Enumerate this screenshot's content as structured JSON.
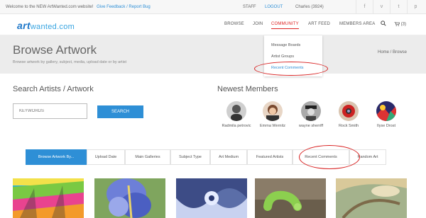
{
  "topbar": {
    "welcome": "Welcome to the NEW ArtWanted.com website!",
    "feedback_link": "Give Feedback / Report Bug",
    "staff": "STAFF",
    "logout": "LOGOUT",
    "user": "Charles (3924)",
    "social_icons": [
      "facebook-icon",
      "vimeo-icon",
      "twitter-icon",
      "pinterest-icon",
      "instagram-icon"
    ],
    "social_glyphs": [
      "f",
      "v",
      "t",
      "p",
      "◎"
    ]
  },
  "nav": {
    "logo_art": "art",
    "logo_rest": "wanted.com",
    "items": [
      "BROWSE",
      "JOIN",
      "COMMUNITY",
      "ART FEED",
      "MEMBERS AREA"
    ],
    "active": "COMMUNITY",
    "search_icon": "search-icon",
    "cart": "(3)"
  },
  "community_menu": {
    "items": [
      "Message Boards",
      "Artist Groups",
      "Recent Comments"
    ],
    "active": "Recent Comments"
  },
  "header": {
    "title": "Browse Artwork",
    "subtitle": "Browse artwork by gallery, subject, media, upload date or by artist",
    "breadcrumb": "Home / Browse"
  },
  "search": {
    "title": "Search Artists / Artwork",
    "placeholder": "KEYWORDS",
    "button": "SEARCH"
  },
  "members": {
    "title": "Newest Members",
    "list": [
      "Radmila petrovic",
      "Emma Wernitz",
      "wayne sherriff",
      "Rock Smith",
      "Ilyse Drost"
    ]
  },
  "tabs": {
    "items": [
      "Browse Artwork By...",
      "Upload Date",
      "Main Galleries",
      "Subject Type",
      "Art Medium",
      "Featured Artists",
      "Recent Comments",
      "Random Art"
    ],
    "active": "Browse Artwork By..."
  },
  "colors": {
    "accent": "#2e8fd6",
    "highlight_ring": "#d81f1f",
    "active_nav": "#dd2222"
  }
}
